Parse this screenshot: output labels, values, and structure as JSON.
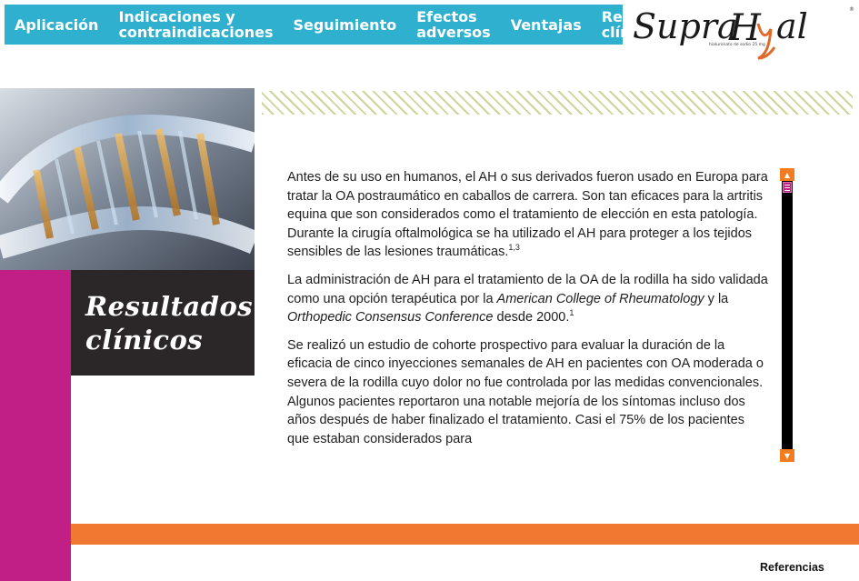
{
  "nav": {
    "items": [
      {
        "label": "Aplicación"
      },
      {
        "label": "Indicaciones y\ncontraindicaciones"
      },
      {
        "label": "Seguimiento"
      },
      {
        "label": "Efectos\nadversos"
      },
      {
        "label": "Ventajas"
      },
      {
        "label": "Resultados\nclínicos"
      }
    ]
  },
  "brand": {
    "name": "SupraHyal",
    "tagline": "hialuronato de sodio 25 mg"
  },
  "section": {
    "title_line1": "Resultados",
    "title_line2": "clínicos"
  },
  "content": {
    "p1_text": "Antes de su uso en humanos, el AH o sus derivados fueron usado en Europa para tratar la OA postraumático en caballos de carrera. Son tan eficaces para la artritis equina que son considerados como el tratamiento de elección en esta patología. Durante la cirugía oftalmológica se ha utilizado el AH para proteger a los tejidos sensibles de las lesiones traumáticas.",
    "p1_ref": "1,3",
    "p2_a": "La administración de AH para el tratamiento de la OA de la rodilla ha sido validada como una opción terapéutica por la ",
    "p2_em1": "American College of Rheumatology",
    "p2_b": " y la ",
    "p2_em2": "Orthopedic Consensus Conference",
    "p2_c": " desde 2000.",
    "p2_ref": "1",
    "p3_text": "Se realizó un estudio de cohorte prospectivo para evaluar la duración de la eficacia de cinco inyecciones semanales de AH en pacientes con OA moderada o severa de la rodilla cuyo dolor no fue controlada por las medidas convencionales. Algunos pacientes reportaron una notable mejoría de los síntomas incluso dos años después de haber finalizado el tratamiento. Casi el 75% de los pacientes que estaban considerados para"
  },
  "footer": {
    "references_label": "Referencias"
  },
  "colors": {
    "nav_bg": "#2fb0cf",
    "magenta": "#c21f86",
    "orange": "#f07830",
    "title_bg": "#2b2627"
  },
  "icons": {
    "scroll_up": "triangle-up-icon",
    "scroll_down": "triangle-down-icon"
  }
}
